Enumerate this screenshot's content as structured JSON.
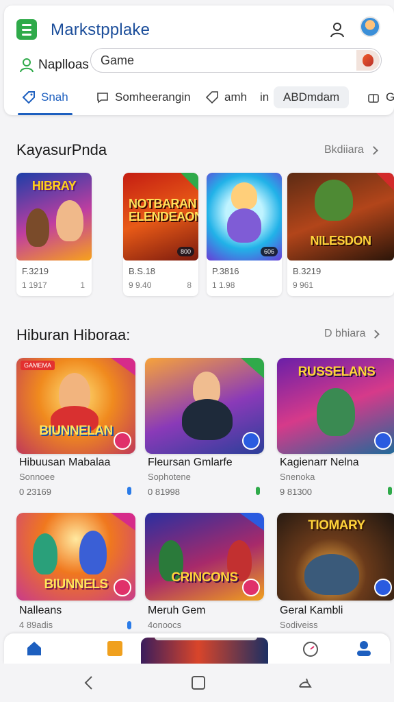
{
  "header": {
    "app_title": "Markstpplake",
    "account_label": "Naplloas",
    "search": {
      "value": "Game",
      "placeholder": "Game"
    }
  },
  "tabs": [
    {
      "label": "Snah",
      "icon": "tag-icon",
      "active": true
    },
    {
      "label": "Somheerangin",
      "icon": "chat-icon",
      "active": false
    },
    {
      "label": "amh",
      "icon": "tag-outline-icon",
      "active": false
    },
    {
      "label": "in",
      "icon": "",
      "active": false
    },
    {
      "label": "ABDmdam",
      "icon": "",
      "active": false
    },
    {
      "label": "Ga",
      "icon": "gift-icon",
      "active": false
    }
  ],
  "section1": {
    "title": "KayasurPnda",
    "see_all": "Bkdiiara",
    "items": [
      {
        "art_text": "HIBRAY",
        "price": "F.3219",
        "meta": "1 1917",
        "idx": "1",
        "badge": ""
      },
      {
        "art_text": "NOTBARAN ELENDEAON",
        "price": "B.S.18",
        "meta": "9 9.40",
        "idx": "8",
        "badge": "800"
      },
      {
        "art_text": "",
        "price": "P.3816",
        "meta": "1 1.98",
        "idx": "",
        "badge": "606"
      },
      {
        "art_text": "NILESDON",
        "price": "B.3219",
        "meta": "9 961",
        "idx": "",
        "badge": ""
      }
    ]
  },
  "section2": {
    "title": "Hiburan Hiboraa:",
    "see_all": "D bhiara",
    "items": [
      {
        "name": "Hibuusan Mabalaa",
        "sub": "Sonnoee",
        "count": "0 23169",
        "art_text": "BIUNNELAN",
        "tag": "GAMEMA"
      },
      {
        "name": "Fleursan Gmlarfe",
        "sub": "Sophotene",
        "count": "0 81998",
        "art_text": "",
        "tag": ""
      },
      {
        "name": "Kagienarr Nelna",
        "sub": "Snenoka",
        "count": "9 81300",
        "art_text": "RUSSELANS",
        "tag": ""
      },
      {
        "name": "Nalleans",
        "sub": "4 89adis",
        "count": "",
        "art_text": "BIUNNELS",
        "tag": ""
      },
      {
        "name": "Meruh Gem",
        "sub": "4onoocs",
        "count": "",
        "art_text": "CRINCONS",
        "tag": ""
      },
      {
        "name": "Geral Kambli",
        "sub": "Sodiveiss",
        "count": "",
        "art_text": "TIOMARY",
        "tag": ""
      }
    ]
  },
  "bottom_nav": [
    "home-icon",
    "store-icon",
    "timer-icon",
    "profile-icon"
  ],
  "system_nav": [
    "back-icon",
    "home-square-icon",
    "recents-icon"
  ],
  "colors": {
    "accent": "#1d5fbf",
    "brand_green": "#2faa4a"
  }
}
